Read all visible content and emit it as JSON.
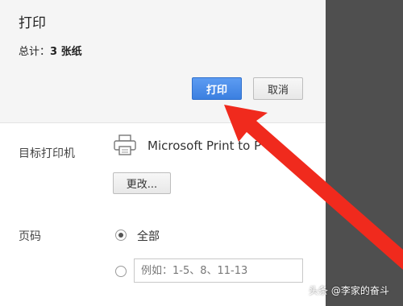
{
  "dialog": {
    "title": "打印",
    "summary_prefix": "总计：",
    "summary_value": "3 张纸",
    "print_button": "打印",
    "cancel_button": "取消"
  },
  "destination": {
    "label": "目标打印机",
    "printer_name": "Microsoft Print to P",
    "change_button": "更改..."
  },
  "pages": {
    "label": "页码",
    "option_all": "全部",
    "custom_placeholder": "例如：1-5、8、11-13"
  },
  "watermark": "头条 @李家的奋斗",
  "colors": {
    "print_button": "#3b7fe0",
    "arrow": "#f02a1d",
    "preview_pane": "#4f4f4f"
  }
}
